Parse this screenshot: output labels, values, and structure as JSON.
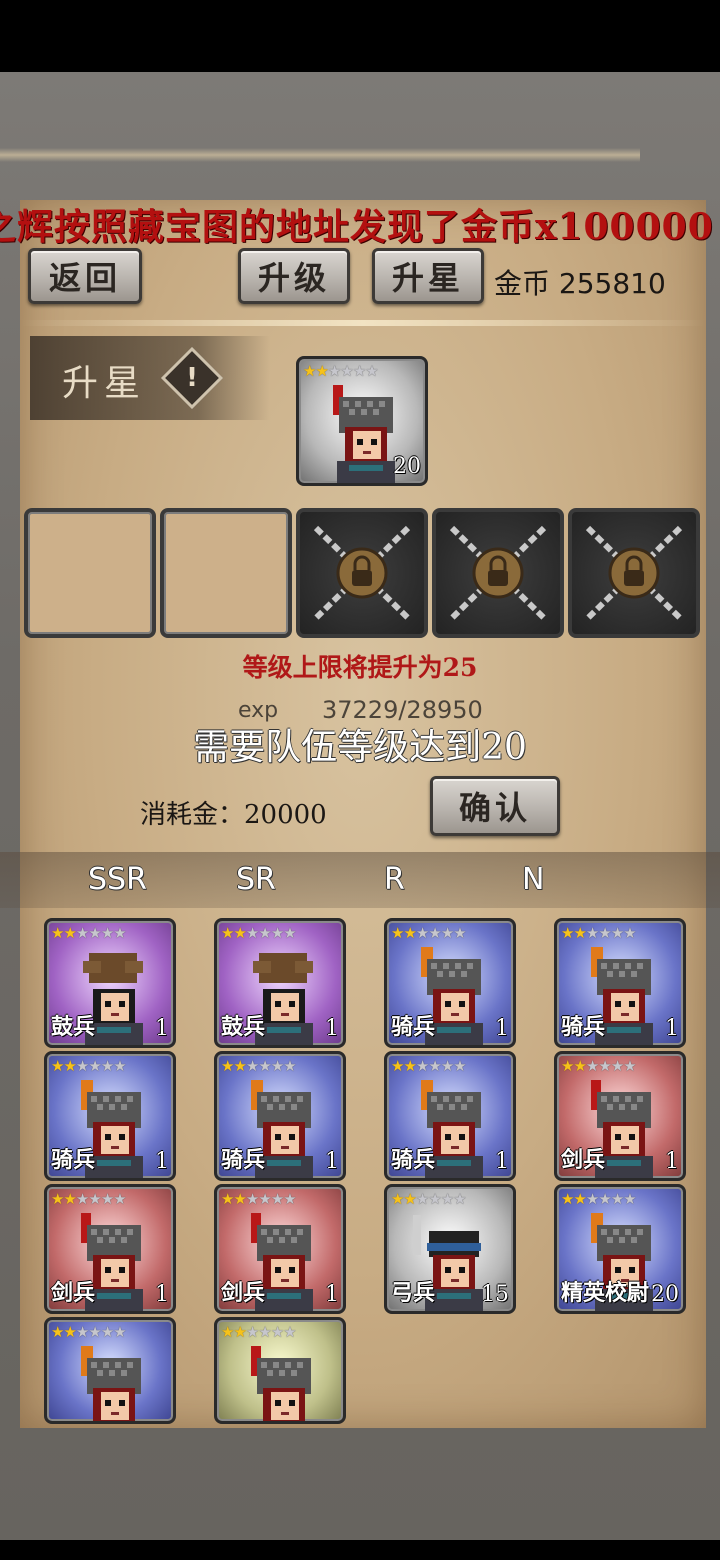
{
  "ticker": "之辉按照藏宝图的地址发现了金币x100000",
  "toolbar": {
    "back_label": "返回",
    "upgrade_label": "升级",
    "star_label": "升星",
    "gold_label": "金币",
    "gold_value": "255810"
  },
  "panel": {
    "section_title": "升星",
    "info_icon": "!",
    "hero": {
      "name": "",
      "level": "20",
      "stars": 2,
      "max_stars": 6,
      "bg": "grey"
    },
    "slots": [
      "empty",
      "empty",
      "locked",
      "locked",
      "locked"
    ],
    "level_cap_text": "等级上限将提升为25",
    "exp_label": "exp",
    "exp_value": "37229/28950",
    "requirement_text": "需要队伍等级达到20",
    "cost_label": "消耗金：",
    "cost_value": "20000",
    "confirm_label": "确认"
  },
  "tabs": [
    {
      "label": "SSR"
    },
    {
      "label": "SR"
    },
    {
      "label": "R"
    },
    {
      "label": "N"
    }
  ],
  "units": [
    {
      "name": "鼓兵",
      "level": "1",
      "stars": 2,
      "bg": "purple",
      "kind": "drummer"
    },
    {
      "name": "鼓兵",
      "level": "1",
      "stars": 2,
      "bg": "purple",
      "kind": "drummer"
    },
    {
      "name": "骑兵",
      "level": "1",
      "stars": 2,
      "bg": "blue",
      "kind": "cavalry"
    },
    {
      "name": "骑兵",
      "level": "1",
      "stars": 2,
      "bg": "blue",
      "kind": "cavalry"
    },
    {
      "name": "骑兵",
      "level": "1",
      "stars": 2,
      "bg": "blue",
      "kind": "cavalry"
    },
    {
      "name": "骑兵",
      "level": "1",
      "stars": 2,
      "bg": "blue",
      "kind": "cavalry"
    },
    {
      "name": "骑兵",
      "level": "1",
      "stars": 2,
      "bg": "blue",
      "kind": "cavalry"
    },
    {
      "name": "剑兵",
      "level": "1",
      "stars": 2,
      "bg": "red",
      "kind": "sword"
    },
    {
      "name": "剑兵",
      "level": "1",
      "stars": 2,
      "bg": "red",
      "kind": "sword"
    },
    {
      "name": "剑兵",
      "level": "1",
      "stars": 2,
      "bg": "red",
      "kind": "sword"
    },
    {
      "name": "弓兵",
      "level": "15",
      "stars": 2,
      "bg": "grey",
      "kind": "archer"
    },
    {
      "name": "精英校尉",
      "level": "20",
      "stars": 2,
      "bg": "blue",
      "kind": "cavalry"
    },
    {
      "name": "",
      "level": "",
      "stars": 2,
      "bg": "blue",
      "kind": "cavalry"
    },
    {
      "name": "",
      "level": "",
      "stars": 2,
      "bg": "olive",
      "kind": "sword"
    }
  ]
}
